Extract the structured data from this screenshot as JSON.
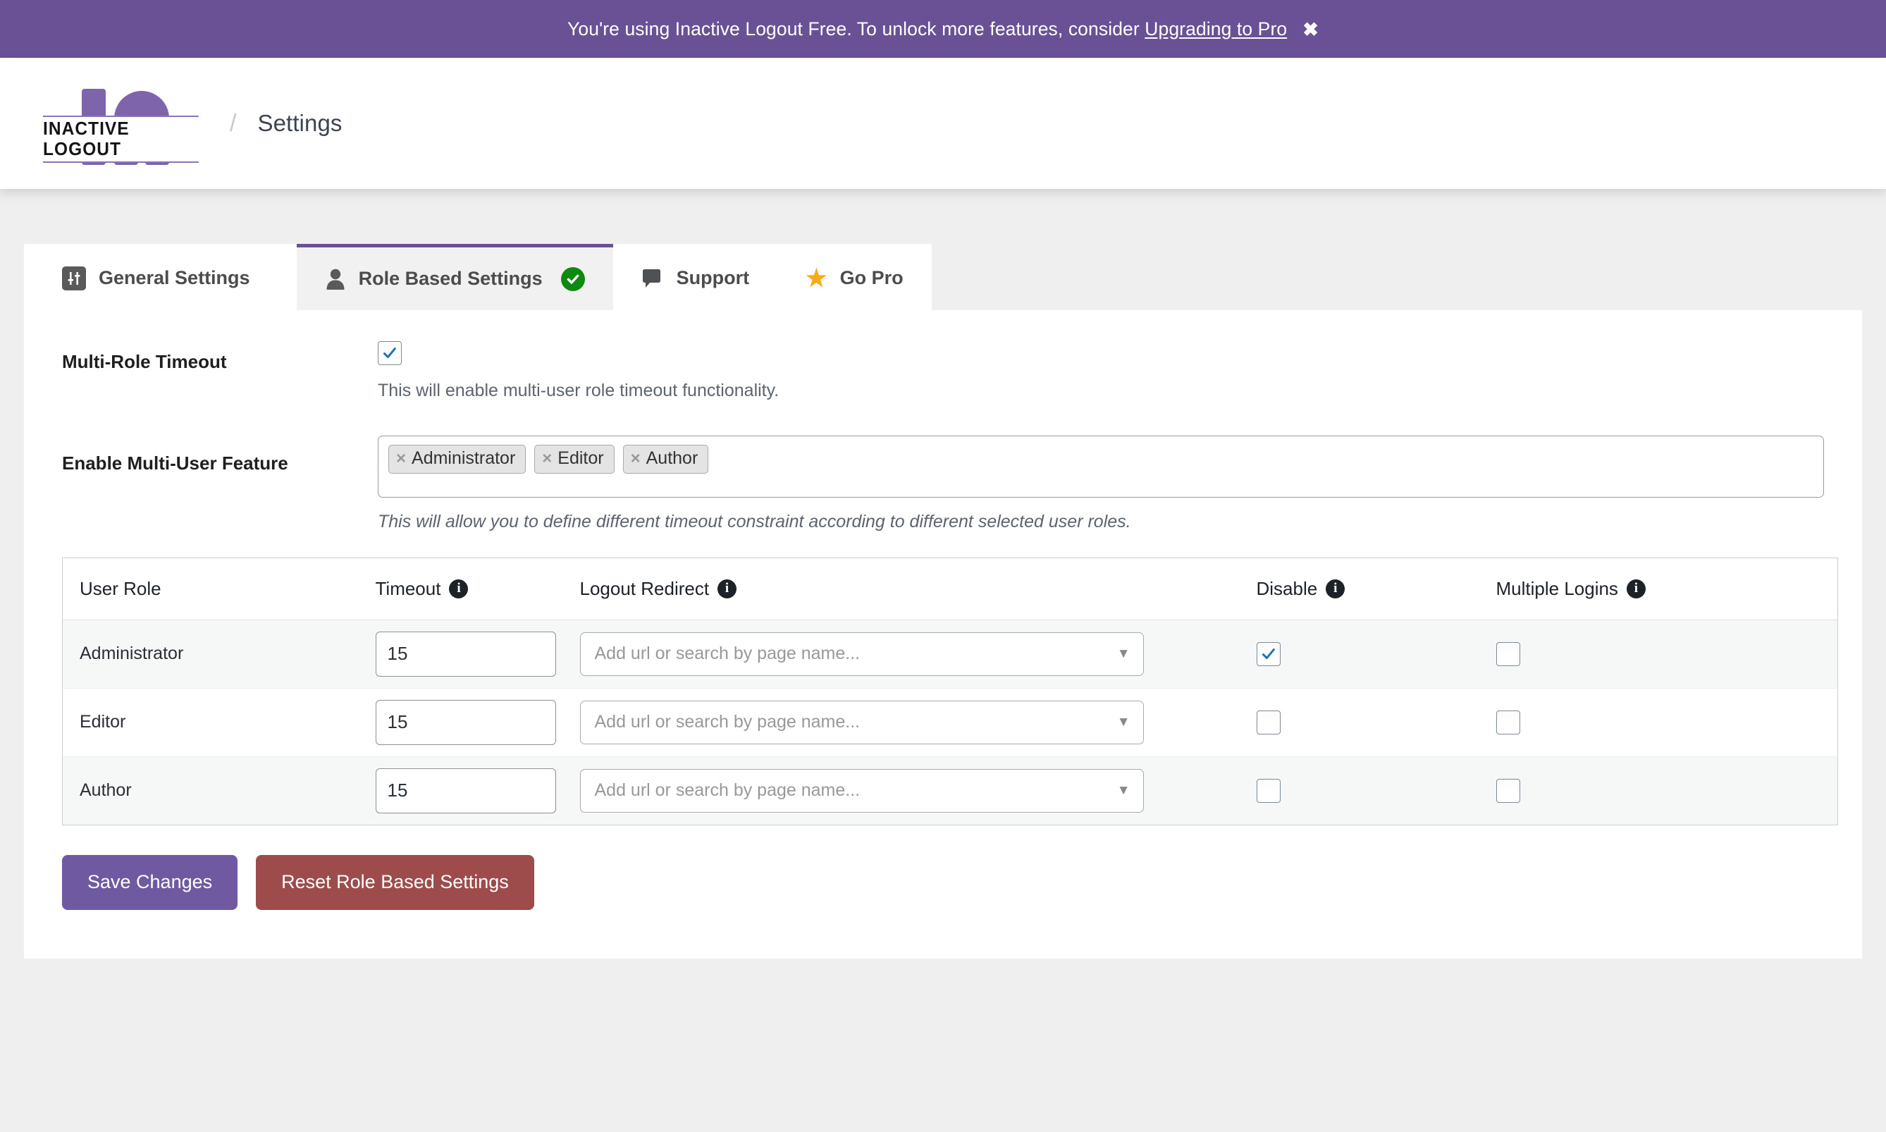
{
  "banner": {
    "message": "You're using Inactive Logout Free. To unlock more features, consider ",
    "link_label": "Upgrading to Pro",
    "close_label": "✖",
    "background": "#6a5196"
  },
  "header": {
    "logo_text": "INACTIVE LOGOUT",
    "separator": "/",
    "page_title": "Settings"
  },
  "tabs": [
    {
      "id": "general",
      "label": "General Settings",
      "icon": "sliders-icon",
      "active": false
    },
    {
      "id": "role_based",
      "label": "Role Based Settings",
      "icon": "user-icon",
      "active": true,
      "badge": "check-badge-icon"
    },
    {
      "id": "support",
      "label": "Support",
      "icon": "comment-icon",
      "active": false
    },
    {
      "id": "go_pro",
      "label": "Go Pro",
      "icon": "star-icon",
      "active": false
    }
  ],
  "settings": {
    "multi_role_timeout": {
      "label": "Multi-Role Timeout",
      "checked": true,
      "description": "This will enable multi-user role timeout functionality."
    },
    "multi_user_feature": {
      "label": "Enable Multi-User Feature",
      "tags": [
        "Administrator",
        "Editor",
        "Author"
      ],
      "tag_remove_glyph": "×",
      "description": "This will allow you to define different timeout constraint according to different selected user roles."
    }
  },
  "table": {
    "headers": [
      {
        "label": "User Role",
        "info": false
      },
      {
        "label": "Timeout",
        "info": true
      },
      {
        "label": "Logout Redirect",
        "info": true
      },
      {
        "label": "Disable",
        "info": true
      },
      {
        "label": "Multiple Logins",
        "info": true
      }
    ],
    "redirect_placeholder": "Add url or search by page name...",
    "rows": [
      {
        "role": "Administrator",
        "timeout": "15",
        "redirect": "",
        "disable": true,
        "multiple_logins": false
      },
      {
        "role": "Editor",
        "timeout": "15",
        "redirect": "",
        "disable": false,
        "multiple_logins": false
      },
      {
        "role": "Author",
        "timeout": "15",
        "redirect": "",
        "disable": false,
        "multiple_logins": false
      }
    ]
  },
  "actions": {
    "save_label": "Save Changes",
    "reset_label": "Reset Role Based Settings",
    "save_color": "#6f5aa1",
    "reset_color": "#9d4b4b"
  }
}
